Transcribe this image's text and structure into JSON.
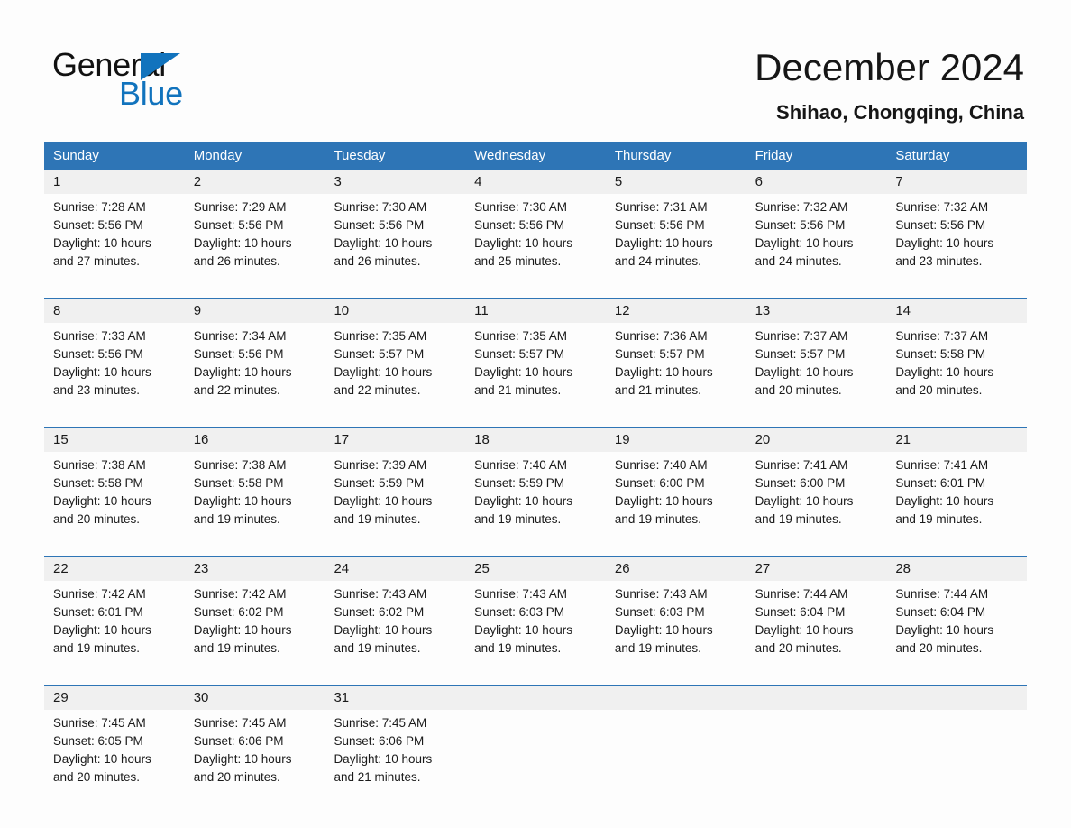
{
  "brand": {
    "name_part1": "General",
    "name_part2": "Blue",
    "triangle_color": "#1173bd",
    "accent_color": "#2e75b6"
  },
  "header": {
    "title": "December 2024",
    "subtitle": "Shihao, Chongqing, China"
  },
  "weekdays": [
    "Sunday",
    "Monday",
    "Tuesday",
    "Wednesday",
    "Thursday",
    "Friday",
    "Saturday"
  ],
  "labels": {
    "sunrise_prefix": "Sunrise:",
    "sunset_prefix": "Sunset:",
    "daylight_prefix": "Daylight:"
  },
  "weeks": [
    [
      {
        "day": "1",
        "sunrise": "Sunrise: 7:28 AM",
        "sunset": "Sunset: 5:56 PM",
        "daylight_line1": "Daylight: 10 hours",
        "daylight_line2": "and 27 minutes."
      },
      {
        "day": "2",
        "sunrise": "Sunrise: 7:29 AM",
        "sunset": "Sunset: 5:56 PM",
        "daylight_line1": "Daylight: 10 hours",
        "daylight_line2": "and 26 minutes."
      },
      {
        "day": "3",
        "sunrise": "Sunrise: 7:30 AM",
        "sunset": "Sunset: 5:56 PM",
        "daylight_line1": "Daylight: 10 hours",
        "daylight_line2": "and 26 minutes."
      },
      {
        "day": "4",
        "sunrise": "Sunrise: 7:30 AM",
        "sunset": "Sunset: 5:56 PM",
        "daylight_line1": "Daylight: 10 hours",
        "daylight_line2": "and 25 minutes."
      },
      {
        "day": "5",
        "sunrise": "Sunrise: 7:31 AM",
        "sunset": "Sunset: 5:56 PM",
        "daylight_line1": "Daylight: 10 hours",
        "daylight_line2": "and 24 minutes."
      },
      {
        "day": "6",
        "sunrise": "Sunrise: 7:32 AM",
        "sunset": "Sunset: 5:56 PM",
        "daylight_line1": "Daylight: 10 hours",
        "daylight_line2": "and 24 minutes."
      },
      {
        "day": "7",
        "sunrise": "Sunrise: 7:32 AM",
        "sunset": "Sunset: 5:56 PM",
        "daylight_line1": "Daylight: 10 hours",
        "daylight_line2": "and 23 minutes."
      }
    ],
    [
      {
        "day": "8",
        "sunrise": "Sunrise: 7:33 AM",
        "sunset": "Sunset: 5:56 PM",
        "daylight_line1": "Daylight: 10 hours",
        "daylight_line2": "and 23 minutes."
      },
      {
        "day": "9",
        "sunrise": "Sunrise: 7:34 AM",
        "sunset": "Sunset: 5:56 PM",
        "daylight_line1": "Daylight: 10 hours",
        "daylight_line2": "and 22 minutes."
      },
      {
        "day": "10",
        "sunrise": "Sunrise: 7:35 AM",
        "sunset": "Sunset: 5:57 PM",
        "daylight_line1": "Daylight: 10 hours",
        "daylight_line2": "and 22 minutes."
      },
      {
        "day": "11",
        "sunrise": "Sunrise: 7:35 AM",
        "sunset": "Sunset: 5:57 PM",
        "daylight_line1": "Daylight: 10 hours",
        "daylight_line2": "and 21 minutes."
      },
      {
        "day": "12",
        "sunrise": "Sunrise: 7:36 AM",
        "sunset": "Sunset: 5:57 PM",
        "daylight_line1": "Daylight: 10 hours",
        "daylight_line2": "and 21 minutes."
      },
      {
        "day": "13",
        "sunrise": "Sunrise: 7:37 AM",
        "sunset": "Sunset: 5:57 PM",
        "daylight_line1": "Daylight: 10 hours",
        "daylight_line2": "and 20 minutes."
      },
      {
        "day": "14",
        "sunrise": "Sunrise: 7:37 AM",
        "sunset": "Sunset: 5:58 PM",
        "daylight_line1": "Daylight: 10 hours",
        "daylight_line2": "and 20 minutes."
      }
    ],
    [
      {
        "day": "15",
        "sunrise": "Sunrise: 7:38 AM",
        "sunset": "Sunset: 5:58 PM",
        "daylight_line1": "Daylight: 10 hours",
        "daylight_line2": "and 20 minutes."
      },
      {
        "day": "16",
        "sunrise": "Sunrise: 7:38 AM",
        "sunset": "Sunset: 5:58 PM",
        "daylight_line1": "Daylight: 10 hours",
        "daylight_line2": "and 19 minutes."
      },
      {
        "day": "17",
        "sunrise": "Sunrise: 7:39 AM",
        "sunset": "Sunset: 5:59 PM",
        "daylight_line1": "Daylight: 10 hours",
        "daylight_line2": "and 19 minutes."
      },
      {
        "day": "18",
        "sunrise": "Sunrise: 7:40 AM",
        "sunset": "Sunset: 5:59 PM",
        "daylight_line1": "Daylight: 10 hours",
        "daylight_line2": "and 19 minutes."
      },
      {
        "day": "19",
        "sunrise": "Sunrise: 7:40 AM",
        "sunset": "Sunset: 6:00 PM",
        "daylight_line1": "Daylight: 10 hours",
        "daylight_line2": "and 19 minutes."
      },
      {
        "day": "20",
        "sunrise": "Sunrise: 7:41 AM",
        "sunset": "Sunset: 6:00 PM",
        "daylight_line1": "Daylight: 10 hours",
        "daylight_line2": "and 19 minutes."
      },
      {
        "day": "21",
        "sunrise": "Sunrise: 7:41 AM",
        "sunset": "Sunset: 6:01 PM",
        "daylight_line1": "Daylight: 10 hours",
        "daylight_line2": "and 19 minutes."
      }
    ],
    [
      {
        "day": "22",
        "sunrise": "Sunrise: 7:42 AM",
        "sunset": "Sunset: 6:01 PM",
        "daylight_line1": "Daylight: 10 hours",
        "daylight_line2": "and 19 minutes."
      },
      {
        "day": "23",
        "sunrise": "Sunrise: 7:42 AM",
        "sunset": "Sunset: 6:02 PM",
        "daylight_line1": "Daylight: 10 hours",
        "daylight_line2": "and 19 minutes."
      },
      {
        "day": "24",
        "sunrise": "Sunrise: 7:43 AM",
        "sunset": "Sunset: 6:02 PM",
        "daylight_line1": "Daylight: 10 hours",
        "daylight_line2": "and 19 minutes."
      },
      {
        "day": "25",
        "sunrise": "Sunrise: 7:43 AM",
        "sunset": "Sunset: 6:03 PM",
        "daylight_line1": "Daylight: 10 hours",
        "daylight_line2": "and 19 minutes."
      },
      {
        "day": "26",
        "sunrise": "Sunrise: 7:43 AM",
        "sunset": "Sunset: 6:03 PM",
        "daylight_line1": "Daylight: 10 hours",
        "daylight_line2": "and 19 minutes."
      },
      {
        "day": "27",
        "sunrise": "Sunrise: 7:44 AM",
        "sunset": "Sunset: 6:04 PM",
        "daylight_line1": "Daylight: 10 hours",
        "daylight_line2": "and 20 minutes."
      },
      {
        "day": "28",
        "sunrise": "Sunrise: 7:44 AM",
        "sunset": "Sunset: 6:04 PM",
        "daylight_line1": "Daylight: 10 hours",
        "daylight_line2": "and 20 minutes."
      }
    ],
    [
      {
        "day": "29",
        "sunrise": "Sunrise: 7:45 AM",
        "sunset": "Sunset: 6:05 PM",
        "daylight_line1": "Daylight: 10 hours",
        "daylight_line2": "and 20 minutes."
      },
      {
        "day": "30",
        "sunrise": "Sunrise: 7:45 AM",
        "sunset": "Sunset: 6:06 PM",
        "daylight_line1": "Daylight: 10 hours",
        "daylight_line2": "and 20 minutes."
      },
      {
        "day": "31",
        "sunrise": "Sunrise: 7:45 AM",
        "sunset": "Sunset: 6:06 PM",
        "daylight_line1": "Daylight: 10 hours",
        "daylight_line2": "and 21 minutes."
      },
      {
        "day": "",
        "sunrise": "",
        "sunset": "",
        "daylight_line1": "",
        "daylight_line2": ""
      },
      {
        "day": "",
        "sunrise": "",
        "sunset": "",
        "daylight_line1": "",
        "daylight_line2": ""
      },
      {
        "day": "",
        "sunrise": "",
        "sunset": "",
        "daylight_line1": "",
        "daylight_line2": ""
      },
      {
        "day": "",
        "sunrise": "",
        "sunset": "",
        "daylight_line1": "",
        "daylight_line2": ""
      }
    ]
  ]
}
